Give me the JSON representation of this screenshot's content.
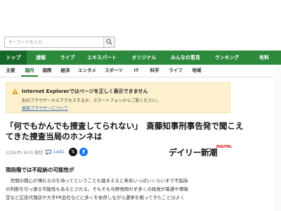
{
  "search": {
    "placeholder": "キーワードを入力"
  },
  "category_nav": {
    "items": [
      {
        "label": "トップ"
      },
      {
        "label": "速報"
      },
      {
        "label": "ライブ"
      },
      {
        "label": "エキスパート"
      },
      {
        "label": "オリジナル"
      },
      {
        "label": "みんなの意見"
      },
      {
        "label": "ランキング"
      },
      {
        "label": "有料"
      }
    ]
  },
  "sub_nav": {
    "items": [
      {
        "label": "主要"
      },
      {
        "label": "国内"
      },
      {
        "label": "国際"
      },
      {
        "label": "経済"
      },
      {
        "label": "エンタメ"
      },
      {
        "label": "スポーツ"
      },
      {
        "label": "IT"
      },
      {
        "label": "科学"
      },
      {
        "label": "ライフ"
      },
      {
        "label": "地域"
      }
    ]
  },
  "ie_notice": {
    "title": "Internet Explorerではページを正しく表示できません",
    "desc": "別のブラウザーからアクセスするか、スマートフォンからご覧ください。",
    "link": "推奨ブラウザーについて"
  },
  "article": {
    "headline_line1": "「何でもかんでも捜査してられない」　斎藤知事刑事告発で聞こえ",
    "headline_line2": "てきた捜査当局のホンネは",
    "date": "12/5(木) 6:01 配信",
    "comment_count": "1441",
    "x_icon": "x-logo-icon",
    "fb_icon": "facebook-icon",
    "source_logo": "デイリー新潮",
    "source_logo_sub": "DIGITAL",
    "section_title": "現段階では不起訴の可能性が",
    "body": [
      "　世間の関心が薄れるのを待ってということも踏まえると来年いっぱいくらいまで不起訴",
      "の判断を引っ張る可能性もあるとされる。そもそも与野党問わず多くの政党が電通や博報",
      "堂など広告代理店や大手PR会社などに多くを依存しながら選挙を戦ってきたことはよく"
    ]
  },
  "colors": {
    "nav_green": "#2b8a3b",
    "nav_active": "#17692a",
    "banner_bg": "#fdf1cd",
    "link_blue": "#3366bb"
  }
}
